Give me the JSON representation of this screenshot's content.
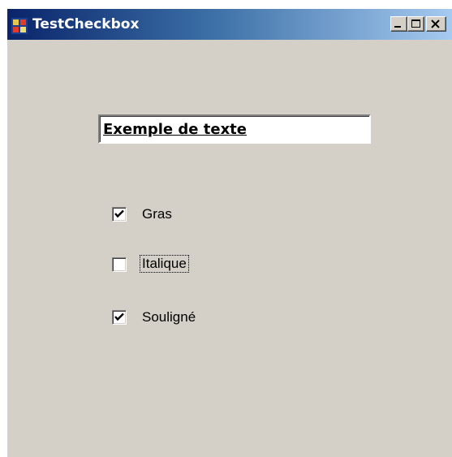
{
  "window": {
    "title": "TestCheckbox",
    "app_icon": "windows-form-icon",
    "caption_buttons": {
      "minimize": "minimize-icon",
      "maximize": "maximize-icon",
      "close": "close-icon"
    }
  },
  "text_field": {
    "value": "Exemple de texte"
  },
  "checkboxes": [
    {
      "label": "Gras",
      "checked": true
    },
    {
      "label": "Italique",
      "checked": false
    },
    {
      "label": "Souligné",
      "checked": true
    }
  ],
  "colors": {
    "title_bar_start": "#0a246a",
    "title_bar_end": "#a6caf0",
    "window_face": "#d4d0c8"
  }
}
